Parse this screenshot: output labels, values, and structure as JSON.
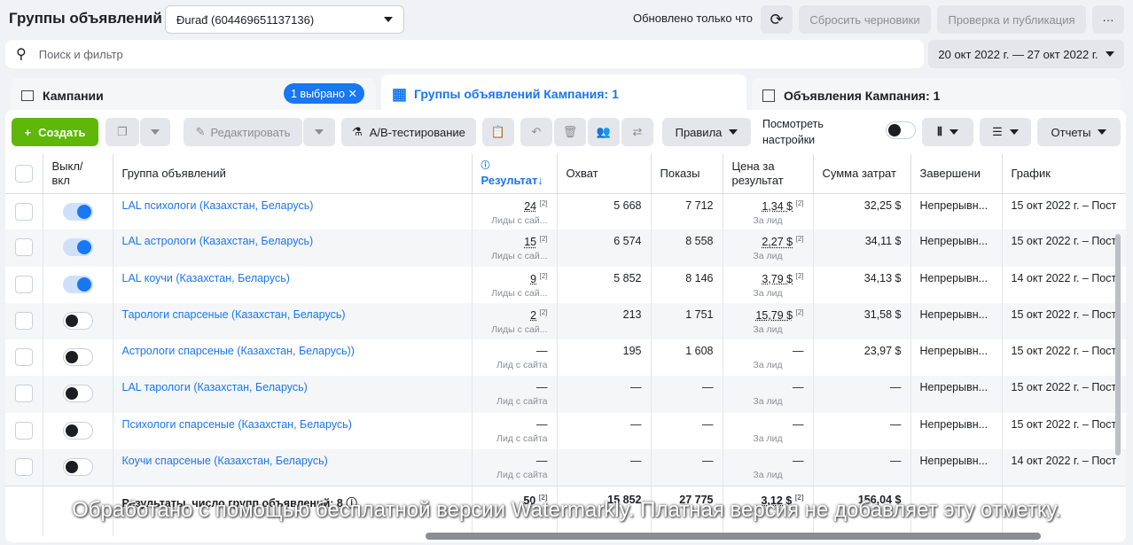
{
  "header": {
    "title": "Группы объявлений",
    "account": "Đurađ (604469651137136)",
    "updated": "Обновлено только что",
    "reset_drafts": "Сбросить черновики",
    "review_publish": "Проверка и публикация",
    "more": "···"
  },
  "search": {
    "placeholder": "Поиск и фильтр",
    "date_range": "20 окт 2022 г. — 27 окт 2022 г."
  },
  "tabs": {
    "campaigns": "Кампании",
    "selected_badge": "1 выбрано",
    "adsets": "Группы объявлений Кампания: 1",
    "ads": "Объявления Кампания: 1"
  },
  "toolbar": {
    "create": "Создать",
    "edit": "Редактировать",
    "ab_test": "A/B-тестирование",
    "rules": "Правила",
    "view_settings": "Посмотреть настройки",
    "reports": "Отчеты"
  },
  "columns": {
    "toggle": "Выкл/ вкл",
    "name": "Группа объявлений",
    "result": "Результат",
    "reach": "Охват",
    "impressions": "Показы",
    "cost": "Цена за результат",
    "spend": "Сумма затрат",
    "end": "Завершени",
    "schedule": "График"
  },
  "rows": [
    {
      "on": true,
      "name": "LAL психологи (Казахстан, Беларусь)",
      "result": "24",
      "result_sub": "Лиды с сай...",
      "reach": "5 668",
      "impressions": "7 712",
      "cost": "1,34 $",
      "cost_sub": "За лид",
      "spend": "32,25 $",
      "end": "Непрерывн...",
      "schedule": "15 окт 2022 г. – Пост"
    },
    {
      "on": true,
      "name": "LAL астрологи (Казахстан, Беларусь)",
      "result": "15",
      "result_sub": "Лиды с сай...",
      "reach": "6 574",
      "impressions": "8 558",
      "cost": "2,27 $",
      "cost_sub": "За лид",
      "spend": "34,11 $",
      "end": "Непрерывн...",
      "schedule": "15 окт 2022 г. – Пост"
    },
    {
      "on": true,
      "name": "LAL коучи (Казахстан, Беларусь)",
      "result": "9",
      "result_sub": "Лиды с сай...",
      "reach": "5 852",
      "impressions": "8 146",
      "cost": "3,79 $",
      "cost_sub": "За лид",
      "spend": "34,13 $",
      "end": "Непрерывн...",
      "schedule": "14 окт 2022 г. – Пост"
    },
    {
      "on": false,
      "name": "Тарологи спарсеные (Казахстан, Беларусь)",
      "result": "2",
      "result_sub": "Лиды с сай...",
      "reach": "213",
      "impressions": "1 751",
      "cost": "15,79 $",
      "cost_sub": "За лид",
      "spend": "31,58 $",
      "end": "Непрерывн...",
      "schedule": "15 окт 2022 г. – Пост"
    },
    {
      "on": false,
      "name": "Астрологи спарсеные (Казахстан, Беларусь))",
      "result": "—",
      "result_sub": "Лид с сайта",
      "reach": "195",
      "impressions": "1 608",
      "cost": "—",
      "cost_sub": "За лид",
      "spend": "23,97 $",
      "end": "Непрерывн...",
      "schedule": "15 окт 2022 г. – Пост"
    },
    {
      "on": false,
      "name": "LAL тарологи (Казахстан, Беларусь)",
      "result": "—",
      "result_sub": "Лид с сайта",
      "reach": "—",
      "impressions": "—",
      "cost": "—",
      "cost_sub": "За лид",
      "spend": "—",
      "end": "Непрерывн...",
      "schedule": "15 окт 2022 г. – Пост"
    },
    {
      "on": false,
      "name": "Психологи спарсеные (Казахстан, Беларусь)",
      "result": "—",
      "result_sub": "Лид с сайта",
      "reach": "—",
      "impressions": "—",
      "cost": "—",
      "cost_sub": "За лид",
      "spend": "—",
      "end": "Непрерывн...",
      "schedule": "15 окт 2022 г. – Пост"
    },
    {
      "on": false,
      "name": "Коучи спарсеные (Казахстан, Беларусь)",
      "result": "—",
      "result_sub": "Лид с сайта",
      "reach": "—",
      "impressions": "—",
      "cost": "—",
      "cost_sub": "За лид",
      "spend": "—",
      "end": "Непрерывн...",
      "schedule": "14 окт 2022 г. – Пост"
    }
  ],
  "totals": {
    "label": "Результаты, число групп объявлений: 8",
    "result": "50",
    "reach": "15 852",
    "impressions": "27 775",
    "cost": "3,12 $",
    "spend": "156,04 $"
  },
  "watermark": "Обработано с помощью бесплатной версии Watermarkly. Платная версия не добавляет эту отметку."
}
